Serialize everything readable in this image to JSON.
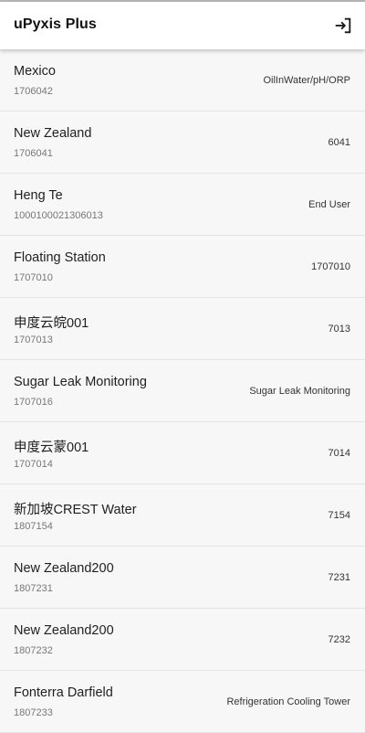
{
  "app_bar": {
    "title": "uPyxis Plus",
    "logout_icon": "logout-icon"
  },
  "sites": [
    {
      "name": "Mexico",
      "id": "1706042",
      "tag": "OilInWater/pH/ORP"
    },
    {
      "name": "New Zealand",
      "id": "1706041",
      "tag": "6041"
    },
    {
      "name": "Heng Te",
      "id": "1000100021306013",
      "tag": "End User"
    },
    {
      "name": "Floating Station",
      "id": "1707010",
      "tag": "1707010"
    },
    {
      "name": "申度云皖001",
      "id": "1707013",
      "tag": "7013"
    },
    {
      "name": "Sugar Leak Monitoring",
      "id": "1707016",
      "tag": "Sugar Leak Monitoring"
    },
    {
      "name": "申度云蒙001",
      "id": "1707014",
      "tag": "7014"
    },
    {
      "name": "新加坡CREST Water",
      "id": "1807154",
      "tag": "7154"
    },
    {
      "name": "New Zealand200",
      "id": "1807231",
      "tag": "7231"
    },
    {
      "name": "New Zealand200",
      "id": "1807232",
      "tag": "7232"
    },
    {
      "name": "Fonterra Darfield",
      "id": "1807233",
      "tag": "Refrigeration Cooling Tower"
    }
  ]
}
